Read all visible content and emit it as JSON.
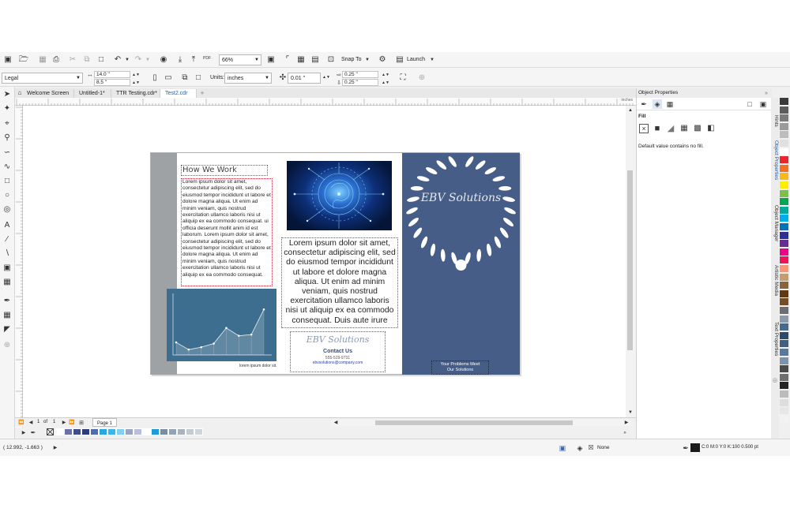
{
  "toolbar": {
    "zoom": "66%",
    "snap_to": "Snap To",
    "launch": "Launch",
    "pdf": "PDF"
  },
  "property_bar": {
    "page_size": "Legal",
    "width": "14.0 \"",
    "height": "8.5 \"",
    "units_label": "Units:",
    "units_value": "inches",
    "nudge": "0.01 \"",
    "dup_x": "0.25 \"",
    "dup_y": "0.25 \""
  },
  "tabs": [
    "Welcome Screen",
    "Untitled-1*",
    "TTR Testing.cdr*",
    "Test2.cdr"
  ],
  "ruler": {
    "unit": "inches"
  },
  "document": {
    "heading": "How We Work",
    "body_text": "Lorem ipsum dolor sit amet, consectetur adipiscing elit, sed do eiusmod tempor incididunt ut labore et dolore magna aliqua. Ut enim ad minim veniam, quis nostrud exercitation ullamco laboris nisi ut aliquip ex ea commodo consequat. ui officia deserunt mollit anim id est laborum. Lorem ipsum dolor sit amet, consectetur adipiscing elit, sed do eiusmod tempor incididunt ut labore et dolore magna aliqua. Ut enim ad minim veniam, quis nostrud exercitation ullamco laboris nisi ut aliquip ex ea commodo consequat.",
    "chart_caption": "lorem ipsum dolor sit.",
    "center_text": "Lorem ipsum dolor sit amet, consectetur adipiscing elit, sed do eiusmod tempor incididunt ut labore et dolore magna aliqua. Ut enim ad minim veniam, quis nostrud exercitation ullamco laboris nisi ut aliquip ex ea commodo consequat. Duis aute irure",
    "logo_small": "EBV Solutions",
    "contact_heading": "Contact Us",
    "contact_phone": "555-529-9731",
    "contact_email": "ebvsolutions@company.com",
    "cover_title": "EBV Solutions",
    "cover_tagline": "Your Problems Meet Our Solutions",
    "cover_color": "#465d87",
    "chart_color": "#3d6e8f",
    "chart_points": [
      0.21,
      0.09,
      0.13,
      0.19,
      0.45,
      0.32,
      0.34,
      0.76
    ]
  },
  "page_nav": {
    "current": "1",
    "of": "of",
    "total": "1",
    "page_tab": "Page 1"
  },
  "panel": {
    "title": "Object Properties",
    "section": "Fill",
    "message": "Default value contains no fill.",
    "side_tabs": [
      "Hints",
      "Object Properties",
      "Object Manager",
      "Artistic Media",
      "Text Properties"
    ]
  },
  "status": {
    "coords": "( 12.992, -1.663 )",
    "fill_none": "None",
    "outline": "C:0 M:0 Y:0 K:100  0.500 pt"
  },
  "palette_bottom": [
    "#ffffff",
    "#6a72a8",
    "#3d4d8f",
    "#2f3b7a",
    "#4f6db0",
    "#2aa6e0",
    "#38b7ea",
    "#7fd0f0",
    "#9aa3c8",
    "#b8bedc",
    "#ffffff",
    "#1f9bd7",
    "#7a8ea3",
    "#94a3b3",
    "#a7b3bf",
    "#c3cbd3",
    "#cfd5db"
  ],
  "palette_right": [
    "#3a3a3a",
    "#5c5c5c",
    "#7a7a7a",
    "#9a9a9a",
    "#bdbdbd",
    "#e0e0e0",
    "#ffffff",
    "#e8262b",
    "#f36f21",
    "#fbb917",
    "#ffed00",
    "#7bc143",
    "#00a651",
    "#00a99d",
    "#00aeef",
    "#0072bc",
    "#2e3192",
    "#662d91",
    "#ec008c",
    "#ed145b",
    "#f7977a",
    "#c69c6d",
    "#8c6239",
    "#603913",
    "#754c24",
    "#6d6e71",
    "#8a9aa8",
    "#4a6a8a",
    "#2e4a6a",
    "#3d5f82",
    "#5a7898",
    "#7a94ae",
    "#4a4a4a",
    "#6e6e6e",
    "#222222",
    "#bbbbbb",
    "#dddddd",
    "#e6e6e6",
    "#f2f2f2"
  ]
}
